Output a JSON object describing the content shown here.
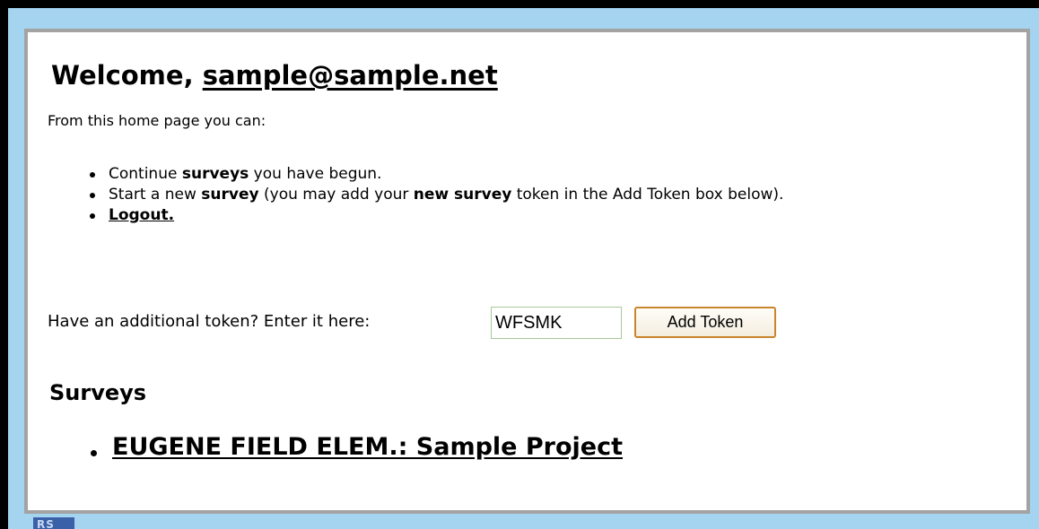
{
  "header": {
    "welcome_prefix": "Welcome, ",
    "user_email": "sample@sample.net"
  },
  "intro": "From this home page you can:",
  "options": {
    "item1": {
      "pre": "Continue ",
      "bold": "surveys",
      "post": " you have begun."
    },
    "item2": {
      "pre": "Start a new ",
      "bold1": "survey",
      "mid": " (you may add your ",
      "bold2": "new survey",
      "post": " token in the Add Token box below)."
    },
    "logout_label": "Logout."
  },
  "token": {
    "label": "Have an additional token? Enter it here:",
    "value": "WFSMK",
    "button_label": "Add Token"
  },
  "surveys": {
    "heading": "Surveys",
    "items": [
      {
        "label": "EUGENE FIELD ELEM.: Sample Project"
      }
    ]
  },
  "corner_logo": {
    "text": "RS"
  },
  "colors": {
    "background": "#a4d4ef",
    "panel_border": "#a3a3a3",
    "button_border": "#c8852a",
    "input_border": "#a7c99a"
  }
}
